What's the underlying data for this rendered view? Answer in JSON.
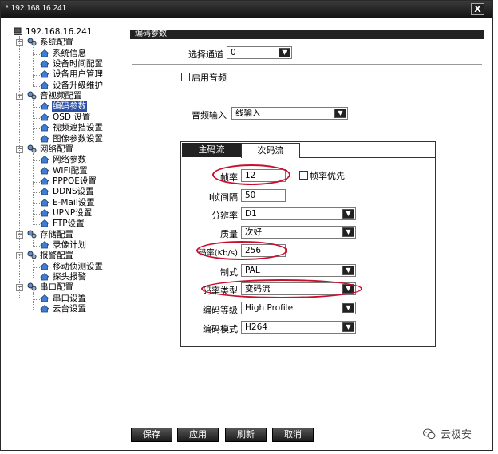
{
  "window": {
    "title": "* 192.168.16.241",
    "close_glyph": "X"
  },
  "tree": {
    "root": "192.168.16.241",
    "groups": [
      {
        "label": "系统配置",
        "items": [
          "系统信息",
          "设备时间配置",
          "设备用户管理",
          "设备升级维护"
        ]
      },
      {
        "label": "音视频配置",
        "items": [
          "编码参数",
          "OSD 设置",
          "视频遮挡设置",
          "图像参数设置"
        ]
      },
      {
        "label": "网络配置",
        "items": [
          "网络参数",
          "WIFI配置",
          "PPPOE设置",
          "DDNS设置",
          "E-Mail设置",
          "UPNP设置",
          "FTP设置"
        ]
      },
      {
        "label": "存储配置",
        "items": [
          "录像计划"
        ]
      },
      {
        "label": "报警配置",
        "items": [
          "移动侦测设置",
          "探头报警"
        ]
      },
      {
        "label": "串口配置",
        "items": [
          "串口设置",
          "云台设置"
        ]
      }
    ],
    "selected": "编码参数"
  },
  "panel": {
    "header": "编码参数",
    "channel_label": "选择通道",
    "channel_value": "0",
    "enable_audio_label": "启用音频",
    "audio_input_label": "音频输入",
    "audio_input_value": "线输入"
  },
  "tabs": {
    "main": "主码流",
    "sub": "次码流"
  },
  "stream": {
    "framerate_label": "帧率",
    "framerate_value": "12",
    "framerate_priority_label": "帧率优先",
    "iframe_label": "I帧间隔",
    "iframe_value": "50",
    "resolution_label": "分辨率",
    "resolution_value": "D1",
    "quality_label": "质量",
    "quality_value": "次好",
    "bitrate_label": "码率(Kb/s)",
    "bitrate_value": "256",
    "standard_label": "制式",
    "standard_value": "PAL",
    "bitrate_type_label": "码率类型",
    "bitrate_type_value": "变码流",
    "profile_label": "编码等级",
    "profile_value": "High Profile",
    "codec_label": "编码模式",
    "codec_value": "H264"
  },
  "buttons": {
    "save": "保存",
    "apply": "应用",
    "refresh": "刷新",
    "cancel": "取消"
  },
  "watermark": {
    "text": "云极安",
    "icon": "wechat-icon"
  },
  "colors": {
    "highlight_circle": "#c8102e",
    "selection": "#2b50a8",
    "titlebar": "#1a1a1a"
  }
}
